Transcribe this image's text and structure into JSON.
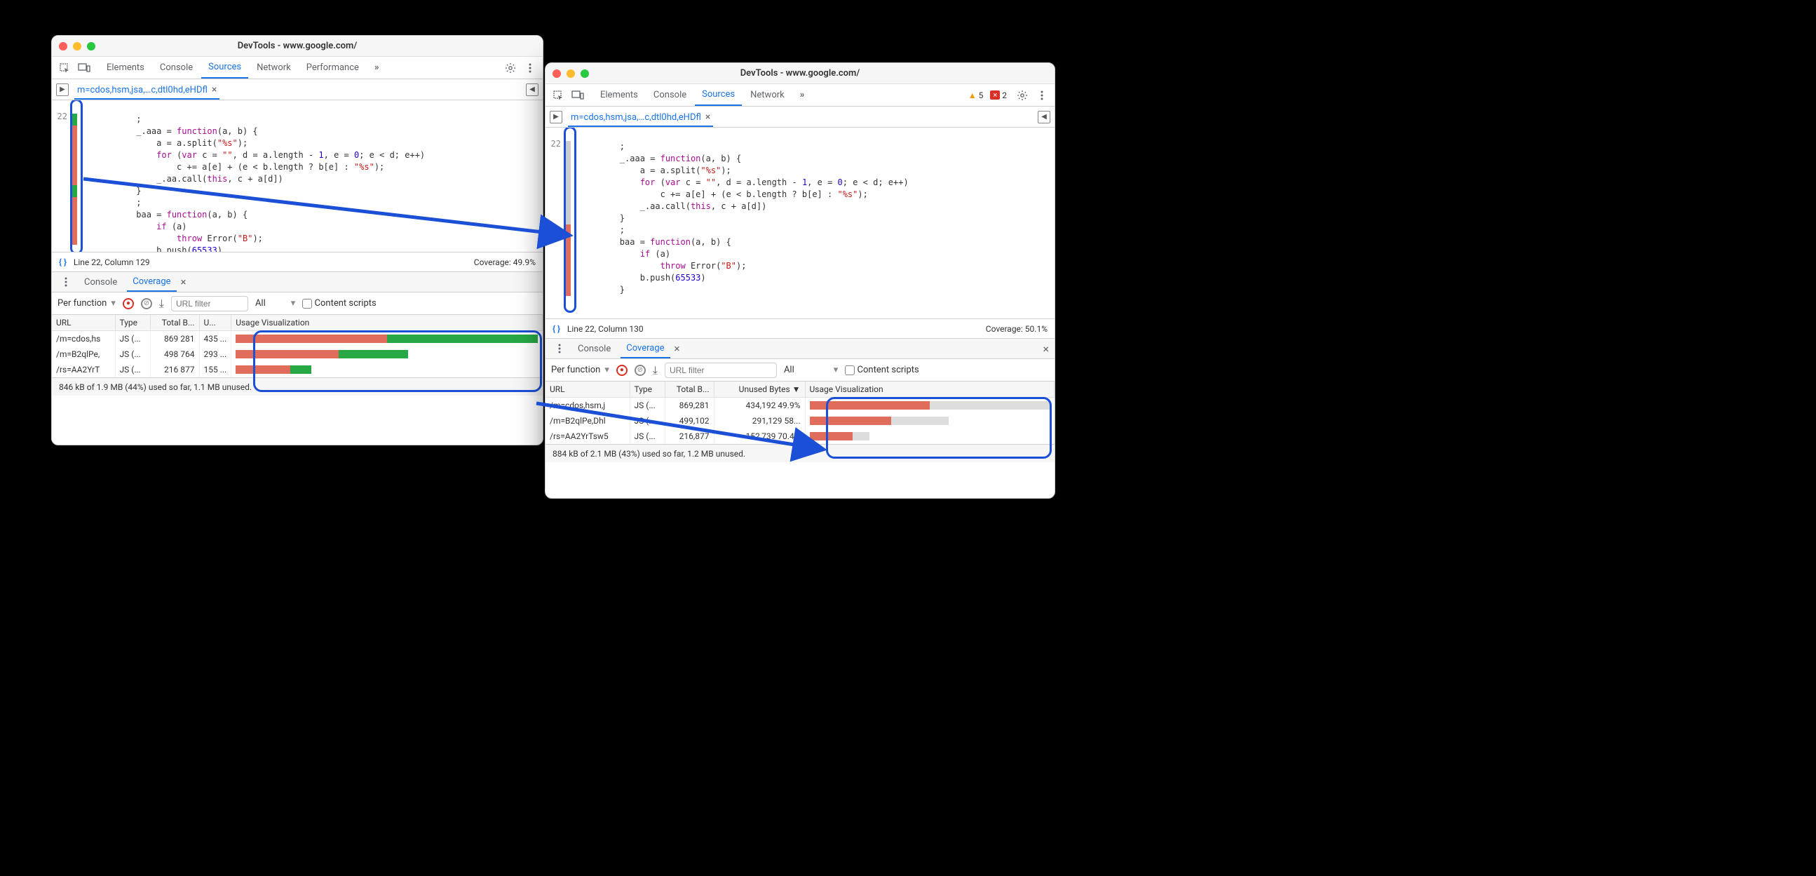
{
  "windows": [
    {
      "title": "DevTools - www.google.com/",
      "tabs": [
        "Elements",
        "Console",
        "Sources",
        "Network",
        "Performance"
      ],
      "activeTab": "Sources",
      "more": "»",
      "warnings": null,
      "errors": null,
      "fileTab": "m=cdos,hsm,jsa,…c,dtl0hd,eHDfl",
      "lineNumber": "22",
      "status": {
        "cursor": "Line 22, Column 129",
        "coverage": "Coverage: 49.9%"
      },
      "drawer": {
        "tabs": [
          "Console",
          "Coverage"
        ],
        "active": "Coverage",
        "perFunction": "Per function",
        "urlPlaceholder": "URL filter",
        "filterSelect": "All",
        "contentScripts": "Content scripts",
        "columns": [
          "URL",
          "Type",
          "Total B...",
          "U...",
          "Usage Visualization"
        ],
        "rows": [
          {
            "url": "/m=cdos,hs",
            "type": "JS (...",
            "total": "869 281",
            "unused": "435 ...",
            "red": 50,
            "green": 50,
            "scale": 100
          },
          {
            "url": "/m=B2qlPe,",
            "type": "JS (...",
            "total": "498 764",
            "unused": "293 ...",
            "red": 34,
            "green": 23,
            "scale": 57
          },
          {
            "url": "/rs=AA2YrT",
            "type": "JS (...",
            "total": "216 877",
            "unused": "155 ...",
            "red": 18,
            "green": 7,
            "scale": 25
          }
        ],
        "footer": "846 kB of 1.9 MB (44%) used so far, 1.1 MB unused."
      }
    },
    {
      "title": "DevTools - www.google.com/",
      "tabs": [
        "Elements",
        "Console",
        "Sources",
        "Network"
      ],
      "activeTab": "Sources",
      "more": "»",
      "warnings": "5",
      "errors": "2",
      "fileTab": "m=cdos,hsm,jsa,…c,dtl0hd,eHDfl",
      "lineNumber": "22",
      "status": {
        "cursor": "Line 22, Column 130",
        "coverage": "Coverage: 50.1%"
      },
      "drawer": {
        "tabs": [
          "Console",
          "Coverage"
        ],
        "active": "Coverage",
        "perFunction": "Per function",
        "urlPlaceholder": "URL filter",
        "filterSelect": "All",
        "contentScripts": "Content scripts",
        "columns": [
          "URL",
          "Type",
          "Total B...",
          "Unused Bytes ▼",
          "Usage Visualization"
        ],
        "rows": [
          {
            "url": "/m=cdos,hsm,j",
            "type": "JS (...",
            "total": "869,281",
            "unused": "434,192  49.9%",
            "red": 50,
            "grey": 50,
            "scale": 100
          },
          {
            "url": "/m=B2qlPe,Dhl",
            "type": "JS (...",
            "total": "499,102",
            "unused": "291,129  58...",
            "red": 34,
            "grey": 24,
            "scale": 58
          },
          {
            "url": "/rs=AA2YrTsw5",
            "type": "JS (...",
            "total": "216,877",
            "unused": "152,739  70.4%",
            "red": 18,
            "grey": 7,
            "scale": 25
          }
        ],
        "footer": "884 kB of 2.1 MB (43%) used so far, 1.2 MB unused."
      }
    }
  ],
  "code": {
    "l1": ";",
    "l2a": "_.aaa = ",
    "l2b": "function",
    "l2c": "(a, b) {",
    "l3a": "    a = a.split(",
    "l3b": "\"%s\"",
    "l3c": ");",
    "l4a": "    ",
    "l4b": "for",
    "l4c": " (",
    "l4d": "var",
    "l4e": " c = ",
    "l4f": "\"\"",
    "l4g": ", d = a.length - ",
    "l4h": "1",
    "l4i": ", e = ",
    "l4j": "0",
    "l4k": "; e < d; e++)",
    "l5a": "        c += a[e] + (e < b.length ? b[e] : ",
    "l5b": "\"%s\"",
    "l5c": ");",
    "l6a": "    _.aa.call(",
    "l6b": "this",
    "l6c": ", c + a[d])",
    "l7": "}",
    "l8": ";",
    "l9a": "baa = ",
    "l9b": "function",
    "l9c": "(a, b) {",
    "l10a": "    ",
    "l10b": "if",
    "l10c": " (a)",
    "l11a": "        ",
    "l11b": "throw",
    "l11c": " Error(",
    "l11d": "\"B\"",
    "l11e": ");",
    "l12a": "    b.push(",
    "l12b": "65533",
    "l12c": ")",
    "l13": "}"
  }
}
